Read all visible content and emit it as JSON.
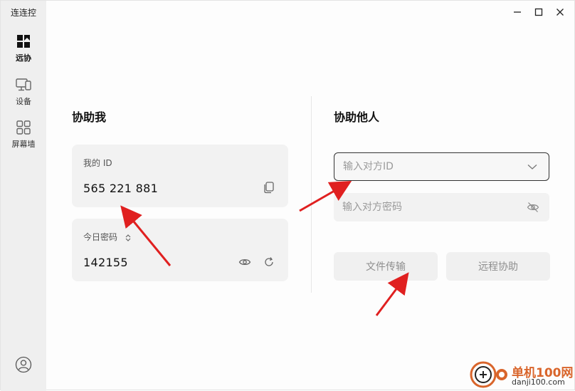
{
  "app": {
    "title": "连连控"
  },
  "sidebar": {
    "items": [
      {
        "label": "远协",
        "icon": "remote-assist-icon"
      },
      {
        "label": "设备",
        "icon": "device-icon"
      },
      {
        "label": "屏幕墙",
        "icon": "screen-wall-icon"
      }
    ],
    "avatar_icon": "user-avatar-icon"
  },
  "assist_me": {
    "title": "协助我",
    "id_label": "我的 ID",
    "id_value": "565 221 881",
    "password_label": "今日密码",
    "password_value": "142155"
  },
  "assist_others": {
    "title": "协助他人",
    "id_placeholder": "输入对方ID",
    "password_placeholder": "输入对方密码",
    "file_transfer_label": "文件传输",
    "remote_assist_label": "远程协助"
  },
  "watermark": {
    "brand": "单机100网",
    "url": "danji100.com"
  },
  "colors": {
    "arrow": "#e02020",
    "watermark_orange": "#d9652b"
  }
}
